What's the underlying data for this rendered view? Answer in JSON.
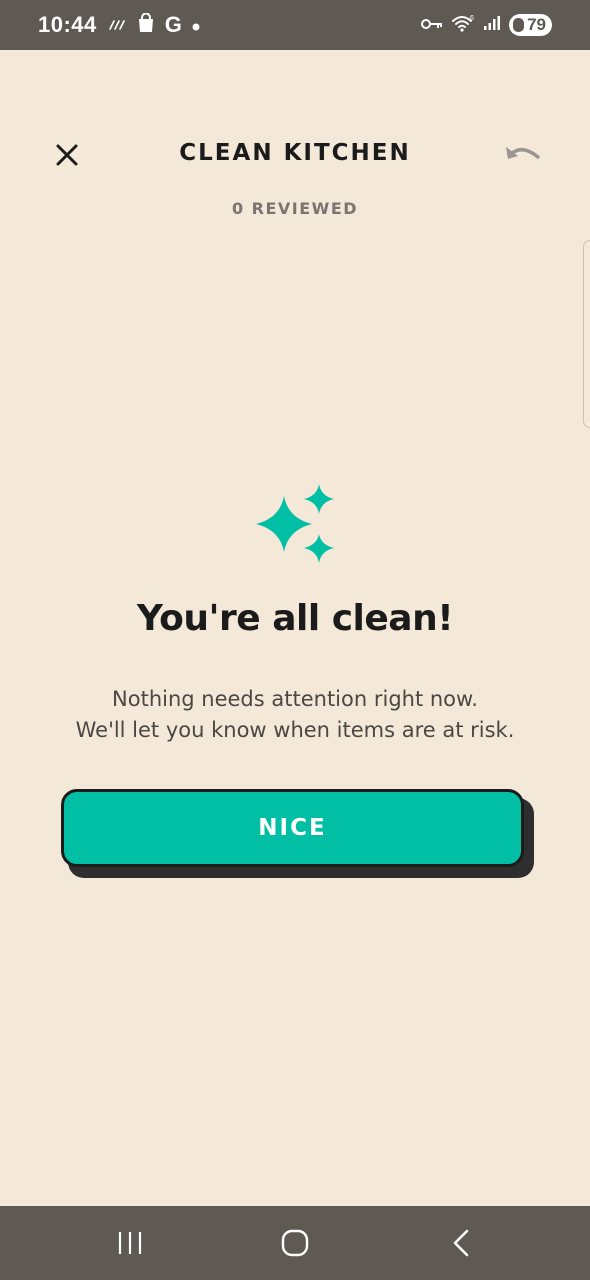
{
  "status_bar": {
    "time": "10:44",
    "google_letter": "G",
    "battery": "79"
  },
  "header": {
    "title": "CLEAN KITCHEN",
    "reviewed": "0 REVIEWED"
  },
  "empty_state": {
    "headline": "You're all clean!",
    "line1": "Nothing needs attention right now.",
    "line2": "We'll let you know when items are at risk."
  },
  "button": {
    "label": "NICE"
  },
  "icons": {
    "close": "close-icon",
    "undo": "undo-icon",
    "sparkles": "sparkles-icon",
    "nav_recents": "recents-icon",
    "nav_home": "home-icon",
    "nav_back": "back-icon"
  },
  "colors": {
    "background": "#f4e9d8",
    "accent": "#00bfa5",
    "system_bar": "#5f5954",
    "text_dark": "#1b1b1b",
    "text_muted": "#7a7570"
  }
}
